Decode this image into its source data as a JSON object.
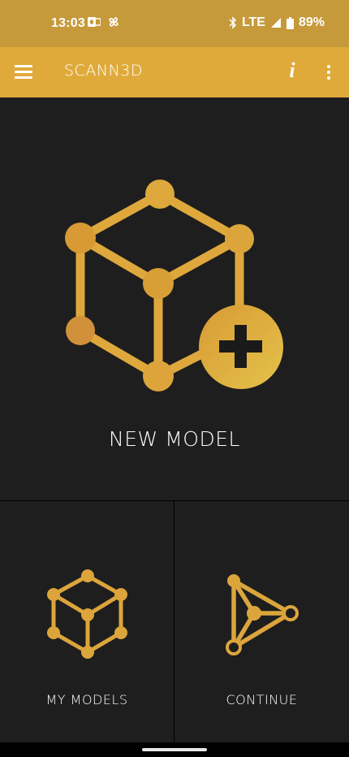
{
  "status_bar": {
    "time": "13:03",
    "network": "LTE",
    "battery": "89%"
  },
  "app_bar": {
    "title": "SCANN3D",
    "info_label": "i"
  },
  "tiles": {
    "new_model": {
      "label": "NEW MODEL",
      "icon": "cube-plus-icon"
    },
    "my_models": {
      "label": "MY MODELS",
      "icon": "cube-network-icon"
    },
    "continue": {
      "label": "CONTINUE",
      "icon": "triangle-network-icon"
    }
  },
  "colors": {
    "status_bar": "#c69a3a",
    "app_bar": "#e0aa3a",
    "background": "#1e1e1e",
    "accent": "#e0a83a"
  }
}
